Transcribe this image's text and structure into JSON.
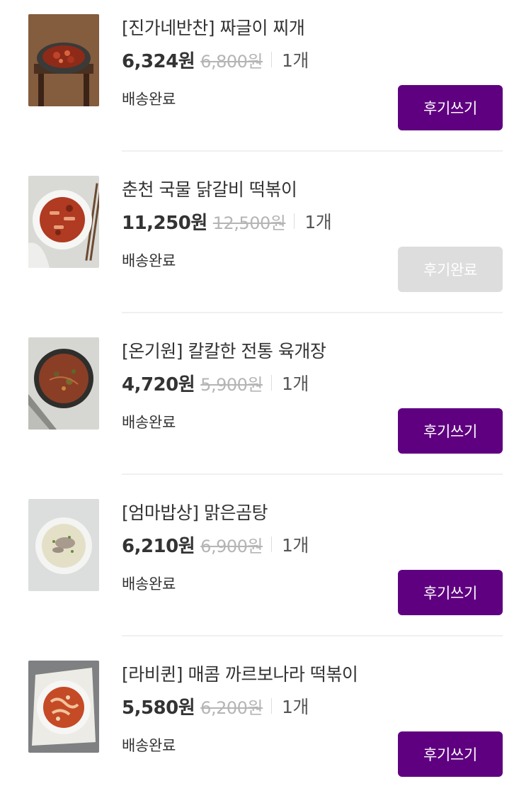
{
  "orders": [
    {
      "title": "[진가네반찬] 짜글이 찌개",
      "price": "6,324원",
      "original_price": "6,800원",
      "quantity": "1개",
      "status": "배송완료",
      "button_label": "후기쓰기",
      "button_state": "active",
      "image_icon": "kimchi-stew-image"
    },
    {
      "title": "춘천 국물 닭갈비 떡볶이",
      "price": "11,250원",
      "original_price": "12,500원",
      "quantity": "1개",
      "status": "배송완료",
      "button_label": "후기완료",
      "button_state": "disabled",
      "image_icon": "tteokbokki-plate-image"
    },
    {
      "title": "[온기원] 칼칼한 전통 육개장",
      "price": "4,720원",
      "original_price": "5,900원",
      "quantity": "1개",
      "status": "배송완료",
      "button_label": "후기쓰기",
      "button_state": "active",
      "image_icon": "yukgaejang-bowl-image"
    },
    {
      "title": "[엄마밥상] 맑은곰탕",
      "price": "6,210원",
      "original_price": "6,900원",
      "quantity": "1개",
      "status": "배송완료",
      "button_label": "후기쓰기",
      "button_state": "active",
      "image_icon": "gomtang-bowl-image"
    },
    {
      "title": "[라비퀸] 매콤 까르보나라 떡볶이",
      "price": "5,580원",
      "original_price": "6,200원",
      "quantity": "1개",
      "status": "배송완료",
      "button_label": "후기쓰기",
      "button_state": "active",
      "image_icon": "carbonara-tteokbokki-image"
    }
  ],
  "colors": {
    "accent": "#5f0080",
    "disabled_button": "#dddddd",
    "strike_price": "#b5b5b5",
    "divider": "#f0f0f0"
  }
}
